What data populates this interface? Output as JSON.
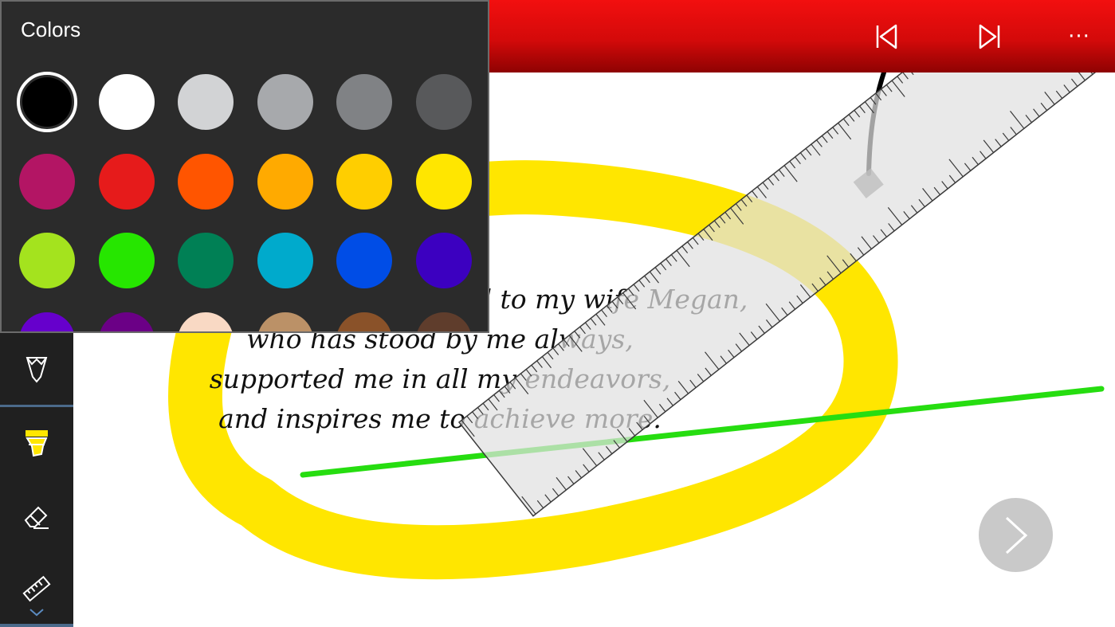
{
  "colors_panel": {
    "title": "Colors",
    "selected_index": 0,
    "swatches": [
      {
        "name": "black",
        "hex": "#000000"
      },
      {
        "name": "white",
        "hex": "#ffffff"
      },
      {
        "name": "light-gray",
        "hex": "#d2d3d5"
      },
      {
        "name": "gray",
        "hex": "#a7a9ac"
      },
      {
        "name": "dark-gray",
        "hex": "#808285"
      },
      {
        "name": "charcoal",
        "hex": "#58595b"
      },
      {
        "name": "magenta",
        "hex": "#b31564"
      },
      {
        "name": "red",
        "hex": "#e61b1b"
      },
      {
        "name": "orange-red",
        "hex": "#ff5500"
      },
      {
        "name": "orange",
        "hex": "#ffaa00"
      },
      {
        "name": "gold",
        "hex": "#ffce00"
      },
      {
        "name": "yellow",
        "hex": "#ffe600"
      },
      {
        "name": "lime",
        "hex": "#a4e31e"
      },
      {
        "name": "green",
        "hex": "#26e600"
      },
      {
        "name": "dark-green",
        "hex": "#008055"
      },
      {
        "name": "cyan",
        "hex": "#00aacc"
      },
      {
        "name": "blue",
        "hex": "#004de6"
      },
      {
        "name": "indigo",
        "hex": "#3c00c0"
      },
      {
        "name": "violet",
        "hex": "#6600cc"
      },
      {
        "name": "purple",
        "hex": "#6b0086"
      },
      {
        "name": "peach",
        "hex": "#f9d9c4"
      },
      {
        "name": "tan",
        "hex": "#bb9167"
      },
      {
        "name": "brown",
        "hex": "#8a5229"
      },
      {
        "name": "dark-brown",
        "hex": "#5f3d2c"
      }
    ]
  },
  "header": {
    "accent_color": "#e00b0b",
    "buttons": [
      {
        "name": "first-page-icon"
      },
      {
        "name": "last-page-icon"
      },
      {
        "name": "more-options-icon",
        "label": "···"
      }
    ]
  },
  "toolbar": {
    "tools": [
      {
        "name": "pen-icon"
      },
      {
        "name": "highlighter-icon",
        "active": true
      },
      {
        "name": "eraser-icon"
      },
      {
        "name": "ruler-icon"
      }
    ],
    "expand_icon": "chevron-down-icon"
  },
  "page": {
    "dedication_lines": [
      "This book is dedicated to my wife Megan,",
      "who has stood by me always,",
      "supported me in all my endeavors,",
      "and inspires me to achieve more."
    ]
  },
  "ink": {
    "highlight_color": "#ffe600",
    "pen_color": "#000000",
    "green_color": "#26dd10"
  }
}
